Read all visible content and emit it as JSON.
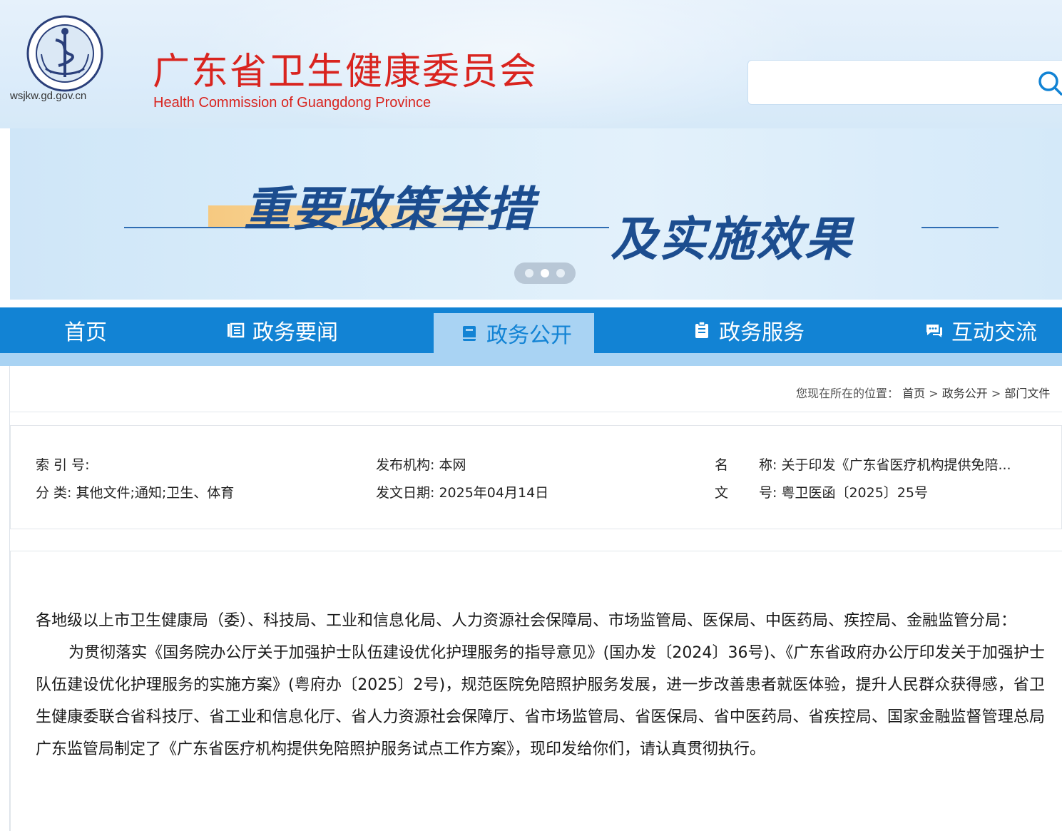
{
  "header": {
    "domain": "wsjkw.gd.gov.cn",
    "title_cn": "广东省卫生健康委员会",
    "title_en": "Health Commission of Guangdong Province",
    "search": {
      "placeholder": "",
      "icon": "search-icon"
    }
  },
  "banner": {
    "title_line1": "重要政策举措",
    "title_line2": "及实施效果",
    "slides_total": 3,
    "slide_active": 2
  },
  "nav": {
    "items": [
      {
        "label": "首页",
        "icon": ""
      },
      {
        "label": "政务要闻",
        "icon": "news-icon"
      },
      {
        "label": "政务公开",
        "icon": "book-icon",
        "active": true
      },
      {
        "label": "政务服务",
        "icon": "clipboard-icon"
      },
      {
        "label": "互动交流",
        "icon": "chat-icon"
      }
    ]
  },
  "breadcrumb": {
    "prefix": "您现在所在的位置：",
    "items": [
      "首页",
      "政务公开",
      "部门文件"
    ],
    "separator": ">"
  },
  "meta": {
    "index_label": "索 引 号:",
    "index_value": "",
    "category_label": "分 类:",
    "category_value": "其他文件;通知;卫生、体育",
    "publisher_label": "发布机构:",
    "publisher_value": "本网",
    "date_label": "发文日期:",
    "date_value": "2025年04月14日",
    "name_label_1": "名",
    "name_label_2": "称:",
    "name_value": "关于印发《广东省医疗机构提供免陪...",
    "docno_label_1": "文",
    "docno_label_2": "号:",
    "docno_value": "粤卫医函〔2025〕25号"
  },
  "body": {
    "addressee": "各地级以上市卫生健康局（委）、科技局、工业和信息化局、人力资源社会保障局、市场监管局、医保局、中医药局、疾控局、金融监管分局：",
    "paragraph1": "为贯彻落实《国务院办公厅关于加强护士队伍建设优化护理服务的指导意见》(国办发〔2024〕36号)、《广东省政府办公厅印发关于加强护士队伍建设优化护理服务的实施方案》(粤府办〔2025〕2号)，规范医院免陪照护服务发展，进一步改善患者就医体验，提升人民群众获得感，省卫生健康委联合省科技厅、省工业和信息化厅、省人力资源社会保障厅、省市场监管局、省医保局、省中医药局、省疾控局、国家金融监督管理总局广东监管局制定了《广东省医疗机构提供免陪照护服务试点工作方案》，现印发给你们，请认真贯彻执行。"
  },
  "colors": {
    "title_red": "#d9241f",
    "nav_blue": "#1283d4",
    "nav_active_bg": "#a9d3f3",
    "banner_text": "#1c4d8f"
  }
}
